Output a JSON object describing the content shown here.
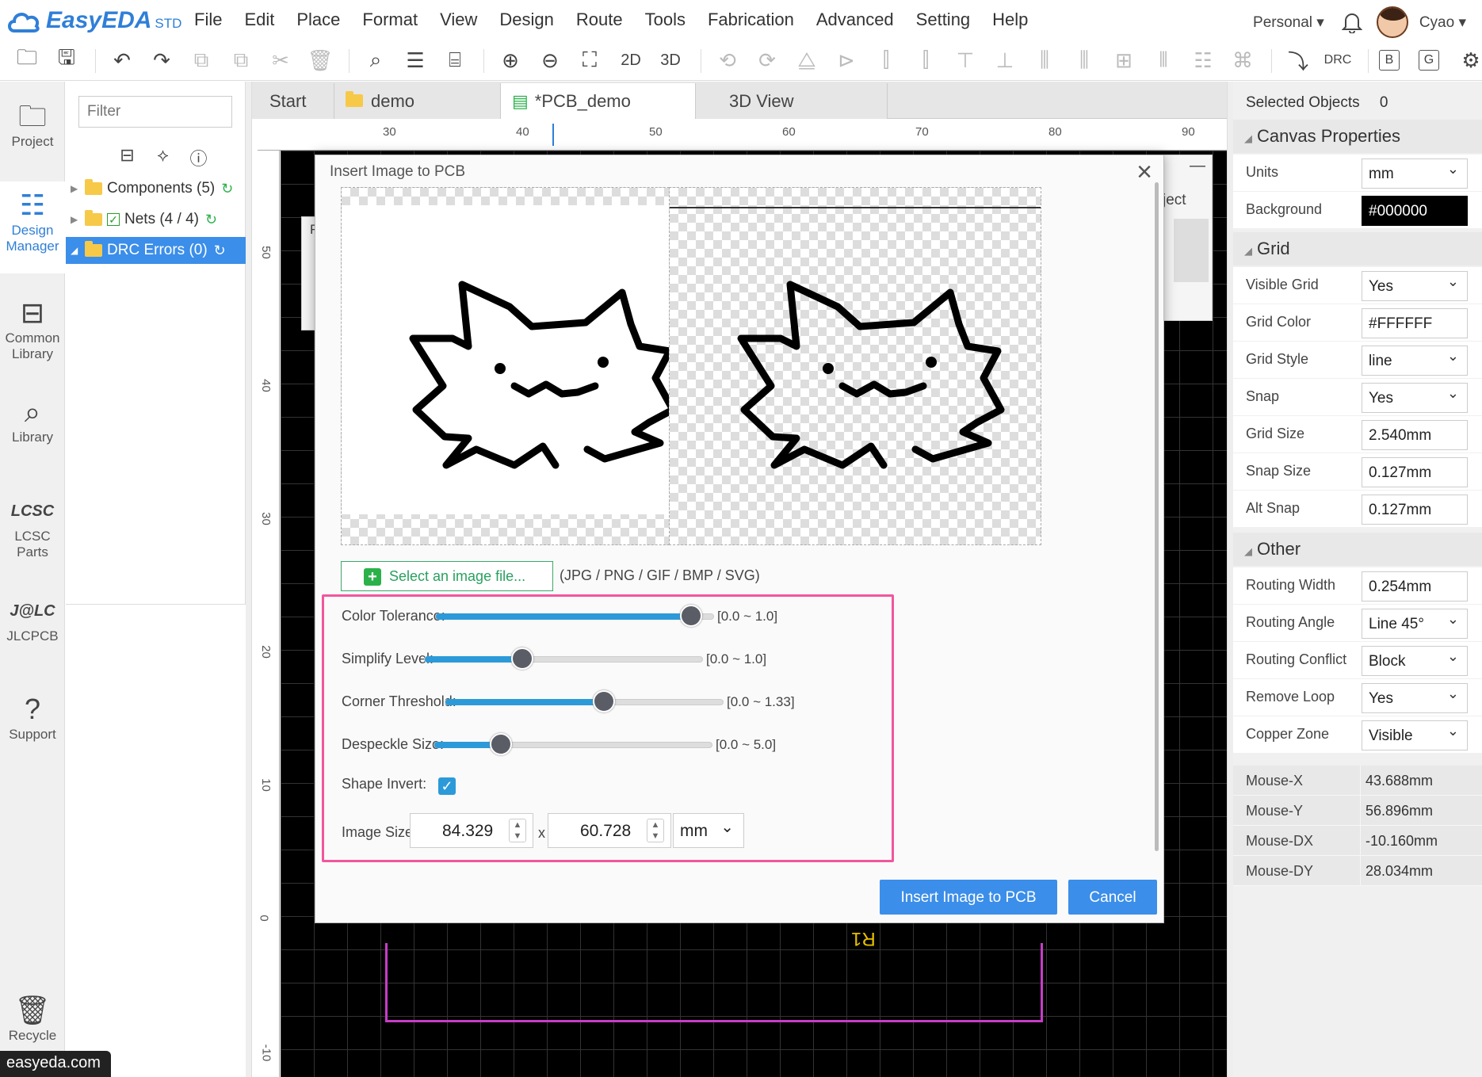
{
  "app": {
    "name": "EasyEDA",
    "edition": "STD"
  },
  "menu": [
    "File",
    "Edit",
    "Place",
    "Format",
    "View",
    "Design",
    "Route",
    "Tools",
    "Fabrication",
    "Advanced",
    "Setting",
    "Help"
  ],
  "user": {
    "plan": "Personal ▾",
    "name": "Cyao ▾"
  },
  "toolbar": {
    "view2d": "2D",
    "view3d": "3D",
    "drc": "DRC",
    "layer_b": "B",
    "layer_g": "G"
  },
  "leftnav": {
    "project": "Project",
    "design_manager_1": "Design",
    "design_manager_2": "Manager",
    "common_library_1": "Common",
    "common_library_2": "Library",
    "library": "Library",
    "lcsc_1": "LCSC",
    "lcsc_2": "Parts",
    "jlcpcb": "JLCPCB",
    "support": "Support",
    "recycle": "Recycle"
  },
  "url_tag": "easyeda.com",
  "tree": {
    "filter_placeholder": "Filter",
    "components": "Components (5)",
    "nets": "Nets (4 / 4)",
    "drc_errors": "DRC Errors (0)"
  },
  "tabs": [
    "Start",
    "demo",
    "*PCB_demo",
    "3D View"
  ],
  "ruler": {
    "top": [
      "30",
      "40",
      "50",
      "60",
      "70",
      "80",
      "90"
    ],
    "left": [
      "50",
      "40",
      "30",
      "20",
      "10",
      "0",
      "-10"
    ]
  },
  "canvas": {
    "silk_label": "R1",
    "bg_panel_text": "ject",
    "bg_panel_f": "F"
  },
  "dialog": {
    "title": "Insert Image to PCB",
    "select_button": "Select an image file...",
    "formats": "(JPG / PNG / GIF / BMP / SVG)",
    "params": {
      "color_tolerance": {
        "label": "Color Tolerance:",
        "range": "[0.0 ~ 1.0]",
        "value_fraction": 0.92
      },
      "simplify_level": {
        "label": "Simplify Level:",
        "range": "[0.0 ~ 1.0]",
        "value_fraction": 0.35
      },
      "corner_threshold": {
        "label": "Corner Threshold:",
        "range": "[0.0 ~ 1.33]",
        "value_fraction": 0.57
      },
      "despeckle_size": {
        "label": "Despeckle Size:",
        "range": "[0.0 ~ 5.0]",
        "value_fraction": 0.24
      },
      "shape_invert": {
        "label": "Shape Invert:",
        "checked": true
      },
      "image_size": {
        "label": "Image Size:",
        "width": "84.329",
        "x": "x",
        "height": "60.728",
        "unit": "mm"
      }
    },
    "insert_button": "Insert Image to PCB",
    "cancel_button": "Cancel"
  },
  "right_panel": {
    "selected_label": "Selected Objects",
    "selected_count": "0",
    "canvas_properties": "Canvas Properties",
    "units": {
      "label": "Units",
      "value": "mm"
    },
    "background": {
      "label": "Background",
      "value": "#000000"
    },
    "grid_section": "Grid",
    "visible_grid": {
      "label": "Visible Grid",
      "value": "Yes"
    },
    "grid_color": {
      "label": "Grid Color",
      "value": "#FFFFFF"
    },
    "grid_style": {
      "label": "Grid Style",
      "value": "line"
    },
    "snap": {
      "label": "Snap",
      "value": "Yes"
    },
    "grid_size": {
      "label": "Grid Size",
      "value": "2.540mm"
    },
    "snap_size": {
      "label": "Snap Size",
      "value": "0.127mm"
    },
    "alt_snap": {
      "label": "Alt Snap",
      "value": "0.127mm"
    },
    "other_section": "Other",
    "routing_width": {
      "label": "Routing Width",
      "value": "0.254mm"
    },
    "routing_angle": {
      "label": "Routing Angle",
      "value": "Line 45°"
    },
    "routing_conflict": {
      "label": "Routing Conflict",
      "value": "Block"
    },
    "remove_loop": {
      "label": "Remove Loop",
      "value": "Yes"
    },
    "copper_zone": {
      "label": "Copper Zone",
      "value": "Visible"
    },
    "mouse_x": {
      "label": "Mouse-X",
      "value": "43.688mm"
    },
    "mouse_y": {
      "label": "Mouse-Y",
      "value": "56.896mm"
    },
    "mouse_dx": {
      "label": "Mouse-DX",
      "value": "-10.160mm"
    },
    "mouse_dy": {
      "label": "Mouse-DY",
      "value": "28.034mm"
    }
  },
  "colors": {
    "accent": "#3b8ee9",
    "highlight": "#f2569c",
    "board_outline": "#c83cc8",
    "silk": "#e8c000"
  }
}
